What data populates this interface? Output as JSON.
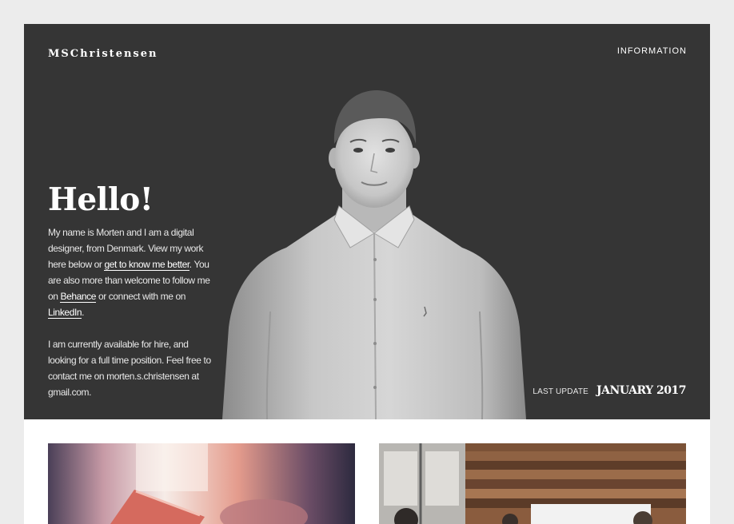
{
  "header": {
    "brand": "MSChristensen",
    "nav_information": "INFORMATION"
  },
  "hero": {
    "greeting": "Hello!",
    "intro": {
      "part1": "My name is Morten and I am a digital designer, from Denmark. View my work here below or ",
      "link_about": "get to know me better",
      "part2": ". You are also more than welcome to follow me on ",
      "link_behance": "Behance",
      "part3": " or connect with me on ",
      "link_linkedin": "LinkedIn",
      "part4": "."
    },
    "availability": "I am currently available for hire, and looking for a full time position. Feel free to contact me on morten.s.christensen at gmail.com.",
    "last_update_label": "LAST UPDATE",
    "last_update_date": "JANUARY 2017"
  },
  "colors": {
    "page_background": "#ececec",
    "hero_background": "#353535",
    "text_light": "#ffffff"
  }
}
